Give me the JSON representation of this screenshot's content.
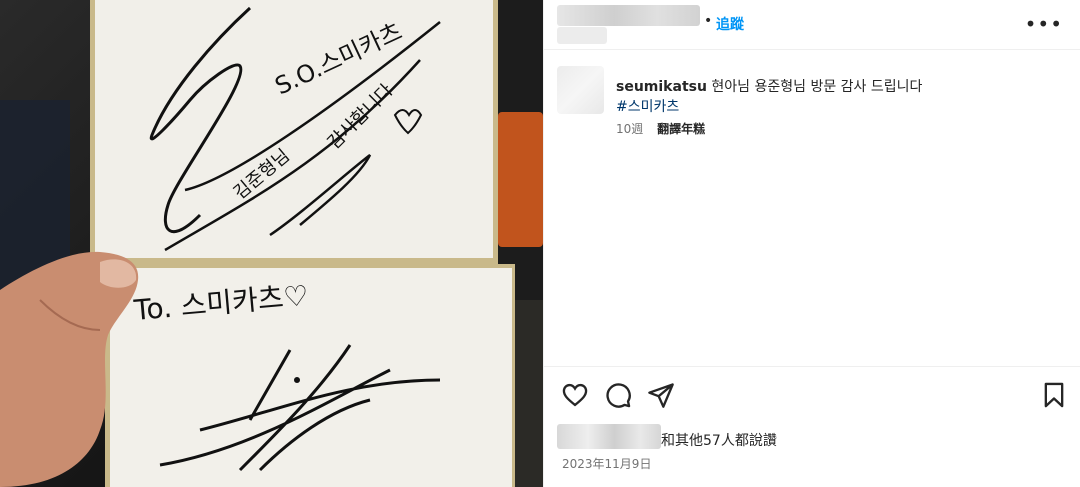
{
  "photo": {
    "card_top_text": "S.O. 스미카츠 김준형님 감사합니다",
    "card_bottom_text": "To. 스미카츠"
  },
  "header": {
    "separator": "•",
    "follow_label": "追蹤",
    "more_label": "•••"
  },
  "caption": {
    "username": "seumikatsu",
    "text": "현아님 용준형님 방문 감사 드립니다",
    "hashtag": "#스미카츠",
    "age": "10週",
    "translate_label": "翻譯年糕"
  },
  "actions": {
    "like_icon": "heart-icon",
    "comment_icon": "comment-icon",
    "share_icon": "send-icon",
    "save_icon": "bookmark-icon"
  },
  "likes_text": "和其他57人都說讚",
  "date": "2023年11月9日",
  "colors": {
    "accent": "#0095f6",
    "hashtag": "#00376b",
    "muted": "#737373",
    "text": "#262626"
  }
}
